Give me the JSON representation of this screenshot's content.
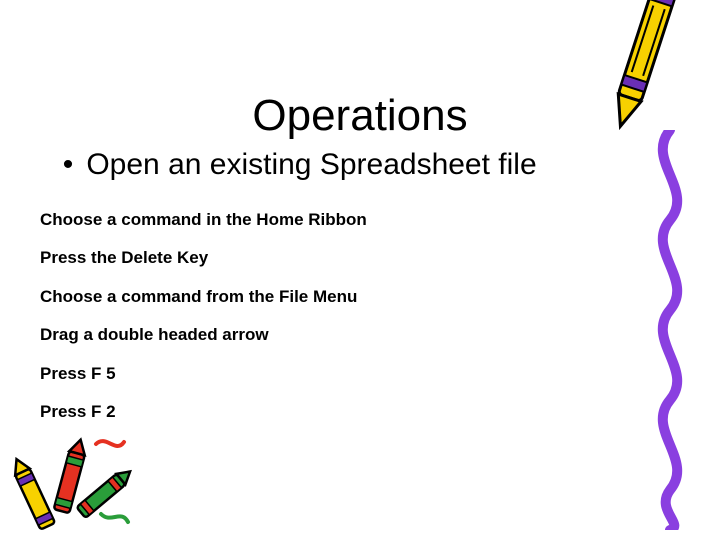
{
  "title": "Operations",
  "bullet_char": "•",
  "question": "Open an existing Spreadsheet file",
  "options": [
    "Choose a command in the Home Ribbon",
    "Press the Delete Key",
    "Choose a command from the File Menu",
    "Drag a double headed arrow",
    "Press F 5",
    "Press F 2"
  ]
}
